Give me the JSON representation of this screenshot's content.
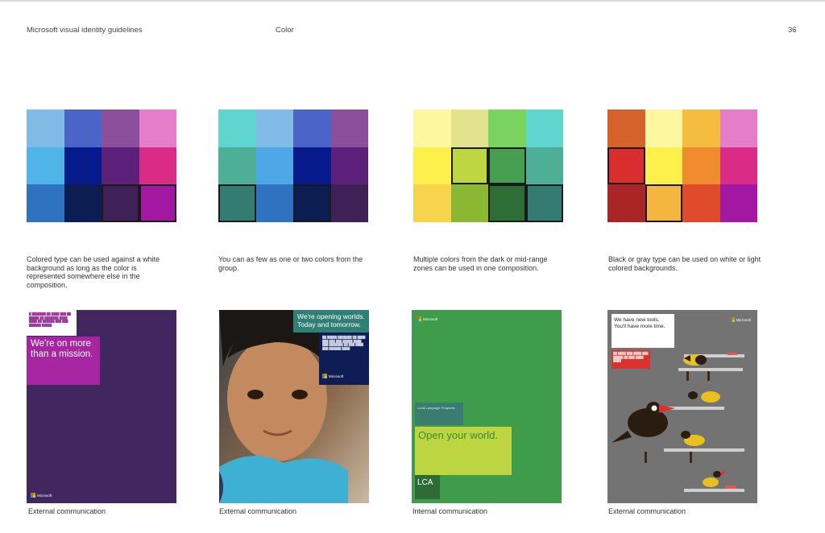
{
  "header": {
    "doc_title": "Microsoft visual identity guidelines",
    "section": "Color",
    "page_number": "36"
  },
  "palettes": [
    {
      "cells": [
        [
          "#7fbbe5",
          "#4b64c8",
          "#8b4e9a",
          "#e57dcb"
        ],
        [
          "#4fb5e8",
          "#071a8c",
          "#5c1f7a",
          "#da2b86"
        ],
        [
          "#2e72c0",
          "#0c1d54",
          "#3f2157",
          "#a318a3"
        ]
      ],
      "highlight": [
        [
          2,
          2
        ],
        [
          2,
          3
        ]
      ]
    },
    {
      "cells": [
        [
          "#5ed5cf",
          "#7fbbe5",
          "#4b64c8",
          "#8b4e9a"
        ],
        [
          "#4caf96",
          "#4ea8e8",
          "#071a8c",
          "#5c1f7a"
        ],
        [
          "#347c72",
          "#2e72c0",
          "#0c1d54",
          "#3f2157"
        ]
      ],
      "highlight": [
        [
          2,
          0
        ],
        [
          2,
          2
        ]
      ]
    },
    {
      "cells": [
        [
          "#fdf8a0",
          "#e2e28c",
          "#79d35e",
          "#5ed5cf"
        ],
        [
          "#fdf04a",
          "#bdd641",
          "#469e50",
          "#4caf96"
        ],
        [
          "#f7d44c",
          "#8ab832",
          "#2e6e36",
          "#347c72"
        ]
      ],
      "highlight": [
        [
          1,
          1
        ],
        [
          1,
          2
        ],
        [
          2,
          2
        ],
        [
          2,
          3
        ]
      ]
    },
    {
      "cells": [
        [
          "#d4622a",
          "#fdf8a0",
          "#f5bd40",
          "#e57dcb"
        ],
        [
          "#d82e2e",
          "#fdf04a",
          "#f08c2e",
          "#da2b86"
        ],
        [
          "#aa2626",
          "#f5b640",
          "#e04c2b",
          "#a318a3"
        ]
      ],
      "highlight": [
        [
          1,
          0
        ],
        [
          2,
          1
        ]
      ]
    }
  ],
  "captions": [
    "Colored type can be used against a white background as long as the color is represented somewhere else in the composition.",
    "You can as few as one or two colors from the group.",
    "Multiple colors from the dark or mid-range zones can be used in one composition.",
    "Black or gray type can be used on white or light colored backgrounds."
  ],
  "posters": {
    "p1": {
      "headline": "We're on more than a mission.",
      "logo": "Microsoft",
      "colors": {
        "bg": "#412660",
        "box": "#a625a0"
      }
    },
    "p2": {
      "headline": "We're opening worlds. Today and tomorrow.",
      "logo": "Microsoft",
      "colors": {
        "head_bg": "#2f7f74",
        "panel_bg": "#0f1d55"
      }
    },
    "p3": {
      "logo": "Microsoft",
      "small_box": "Local Language Programs",
      "headline": "Open your world.",
      "footer_box": "LCA",
      "colors": {
        "bg": "#3f9c4b",
        "teal": "#3a7d70",
        "lime": "#bcd541",
        "dark": "#2d6c36"
      }
    },
    "p4": {
      "headline": "We have new tools. You'll have more time.",
      "logo": "Microsoft",
      "colors": {
        "bg": "#737373",
        "red": "#d8312e"
      }
    }
  },
  "labels": [
    "External communication",
    "External communication",
    "Internal communication",
    "External communication"
  ]
}
